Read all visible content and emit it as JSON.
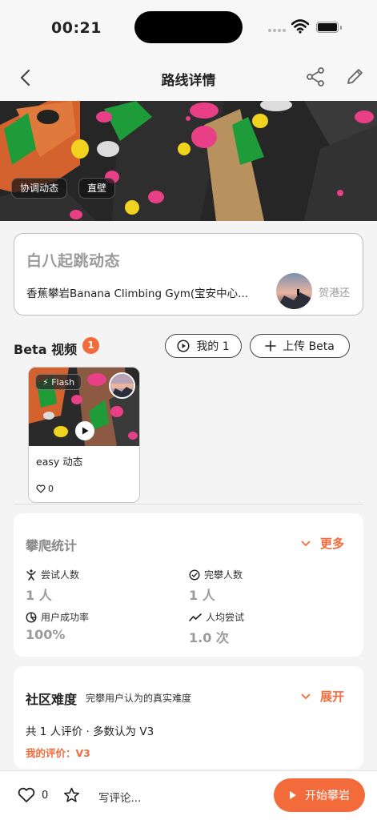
{
  "status": {
    "time": "00:21"
  },
  "nav": {
    "title": "路线详情"
  },
  "hero": {
    "tags": [
      "协调动态",
      "直壁"
    ]
  },
  "route": {
    "name": "白八起跳动态",
    "gym": "香蕉攀岩Banana Climbing Gym(宝安中心...",
    "setter": "贺港还"
  },
  "beta": {
    "title": "Beta 视频",
    "count": "1",
    "mine_label": "我的 1",
    "upload_label": "上传 Beta",
    "videos": [
      {
        "flash": "Flash",
        "label": "easy 动态",
        "likes": "0"
      }
    ]
  },
  "stats": {
    "title": "攀爬统计",
    "more": "更多",
    "items": [
      {
        "label": "尝试人数",
        "value": "1 人",
        "icon": "climber-icon"
      },
      {
        "label": "完攀人数",
        "value": "1 人",
        "icon": "check-circle-icon"
      },
      {
        "label": "用户成功率",
        "value": "100%",
        "icon": "pie-icon"
      },
      {
        "label": "人均尝试",
        "value": "1.0 次",
        "icon": "trend-icon"
      }
    ]
  },
  "community": {
    "title": "社区难度",
    "subtitle": "完攀用户认为的真实难度",
    "expand": "展开",
    "summary": "共 1 人评价 · 多数认为 V3",
    "mine": "我的评价：V3"
  },
  "bottom": {
    "likes": "0",
    "comment_placeholder": "写评论...",
    "start_label": "开始攀岩"
  },
  "colors": {
    "accent": "#f36b3b"
  }
}
